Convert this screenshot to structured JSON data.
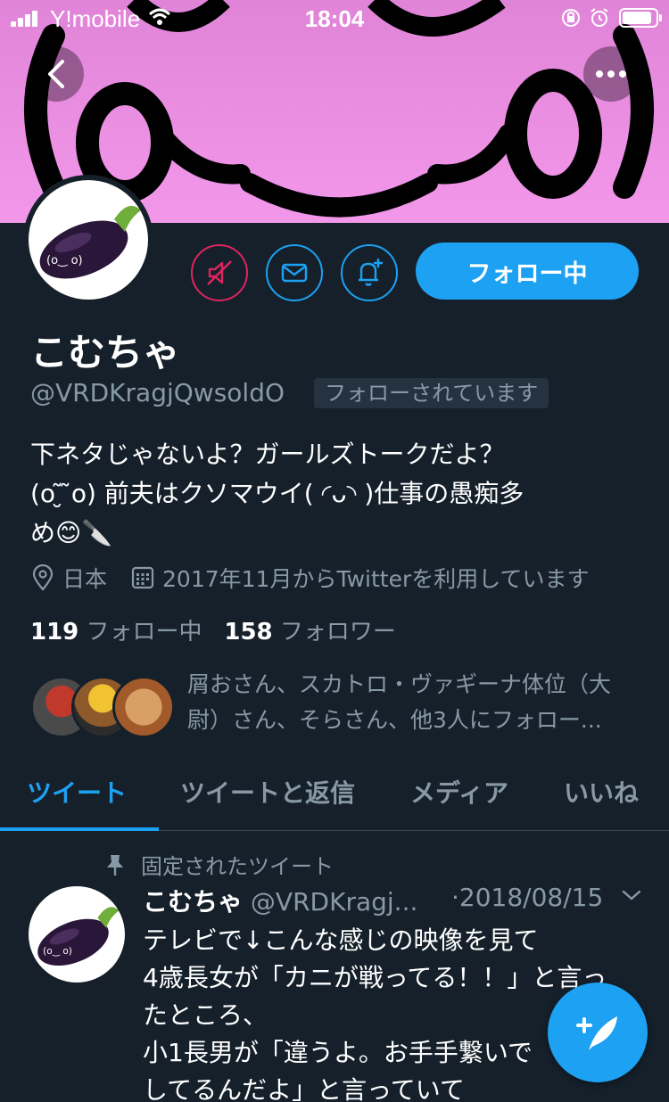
{
  "status_bar": {
    "carrier": "Y!mobile",
    "time": "18:04"
  },
  "profile": {
    "display_name": "こむちゃ",
    "handle": "@VRDKragjQwsoldO",
    "follows_you_badge": "フォローされています",
    "follow_button_label": "フォロー中",
    "bio_lines": [
      "下ネタじゃないよ？ガールズトークだよ？",
      "(o ̃͏̮͏ ̃o) 前夫はクソマウイ( ◜ᴗ◝ )仕事の愚痴多",
      "め😊🔪"
    ],
    "location": "日本",
    "joined": "2017年11月からTwitterを利用しています",
    "following_count": "119",
    "following_label": "フォロー中",
    "followers_count": "158",
    "followers_label": "フォロワー",
    "known_followers_text": "屑おさん、スカトロ・ヴァギーナ体位（大尉）さん、そらさん、他3人にフォロー..."
  },
  "tabs": [
    {
      "label": "ツイート"
    },
    {
      "label": "ツイートと返信"
    },
    {
      "label": "メディア"
    },
    {
      "label": "いいね"
    }
  ],
  "pinned_tweet": {
    "pinned_label": "固定されたツイート",
    "author_name": "こむちゃ",
    "author_handle": "@VRDKragj...",
    "date": "·2018/08/15",
    "body_lines": [
      "テレビで↓こんな感じの映像を見て",
      "4歳長女が「カニが戦ってる！！」と言っ",
      "たところ、",
      "小1長男が「違うよ。お手手繋いで",
      "してるんだよ」と言っていて"
    ]
  },
  "colors": {
    "background": "#15202b",
    "accent": "#1da1f2",
    "mute_red": "#e0245e",
    "secondary_text": "#8899a6",
    "banner_pink": "#f297ea"
  },
  "icons": [
    "back-icon",
    "more-icon",
    "mute-icon",
    "mail-icon",
    "bell-plus-icon",
    "location-icon",
    "calendar-icon",
    "pin-icon",
    "chevron-down-icon",
    "compose-icon"
  ]
}
